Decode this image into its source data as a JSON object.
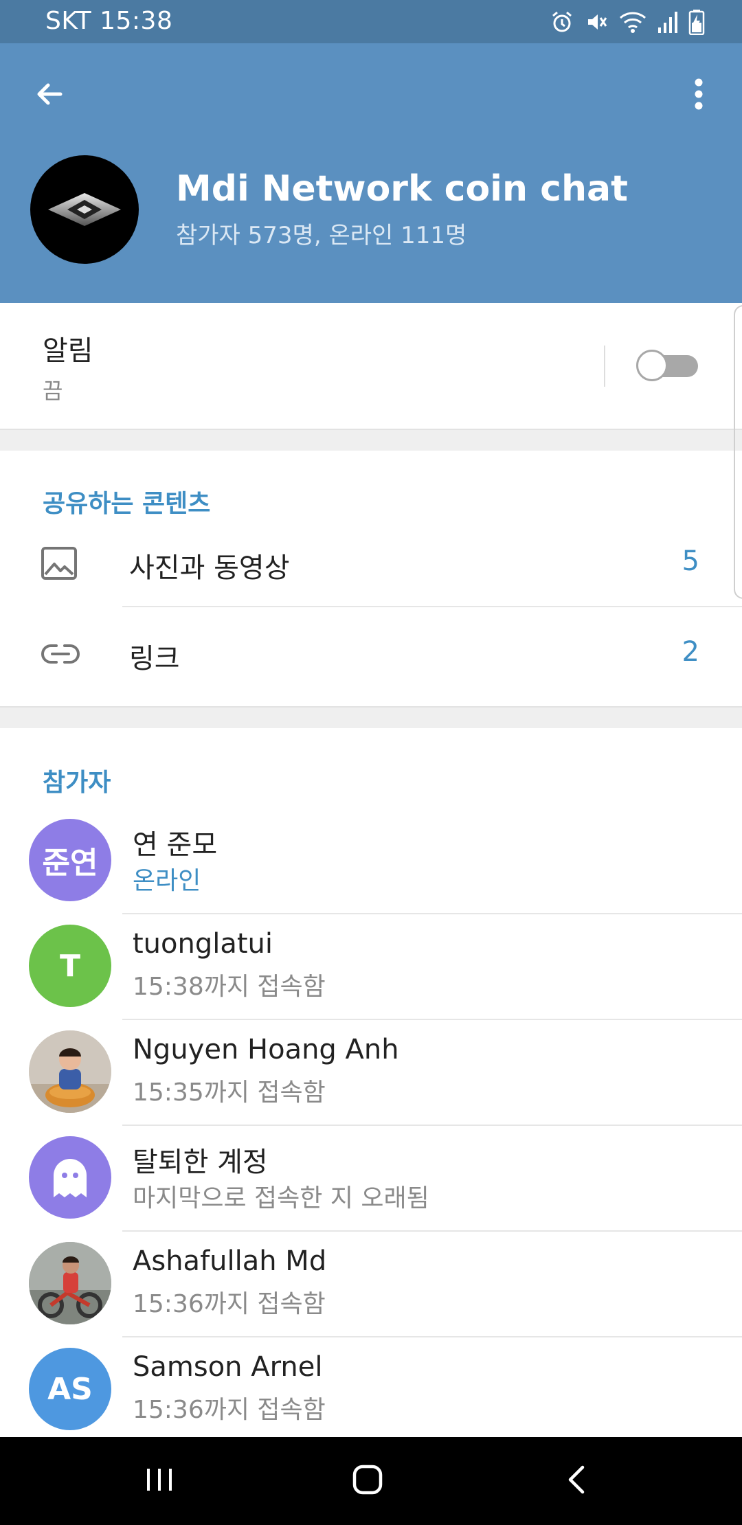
{
  "status_bar": {
    "carrier_time": "SKT 15:38",
    "icons": [
      "alarm-icon",
      "vibrate-mute-icon",
      "wifi-icon",
      "signal-icon",
      "battery-charging-icon"
    ]
  },
  "header": {
    "title": "Mdi Network coin chat",
    "subtitle": "참가자 573명, 온라인 111명",
    "back_icon": "back-arrow-icon",
    "menu_icon": "more-vertical-icon",
    "bg_color": "#5b90c0"
  },
  "notifications": {
    "label": "알림",
    "value": "끔",
    "enabled": false
  },
  "shared_content": {
    "title": "공유하는 콘텐츠",
    "items": [
      {
        "icon": "image-icon",
        "label": "사진과 동영상",
        "count": "5"
      },
      {
        "icon": "link-icon",
        "label": "링크",
        "count": "2"
      }
    ]
  },
  "members": {
    "title": "참가자",
    "items": [
      {
        "avatar_text": "준연",
        "avatar_color": "#8e7de6",
        "name": "연 준모",
        "status": "온라인",
        "online": true
      },
      {
        "avatar_text": "T",
        "avatar_color": "#6cc24a",
        "name": "tuonglatui",
        "status": "15:38까지 접속함",
        "online": false
      },
      {
        "avatar_text": "",
        "avatar_color": "#b9a48a",
        "name": "Nguyen Hoang Anh",
        "status": "15:35까지 접속함",
        "online": false
      },
      {
        "avatar_text": "",
        "avatar_color": "#8e7de6",
        "name": "탈퇴한 계정",
        "status": "마지막으로 접속한 지 오래됨",
        "online": false
      },
      {
        "avatar_text": "",
        "avatar_color": "#9a9f9a",
        "name": "Ashafullah Md",
        "status": "15:36까지 접속함",
        "online": false
      },
      {
        "avatar_text": "AS",
        "avatar_color": "#4e98e0",
        "name": "Samson Arnel",
        "status": "15:36까지 접속함",
        "online": false
      }
    ]
  },
  "nav_bar": {
    "buttons": [
      "recent-apps-icon",
      "home-icon",
      "back-icon"
    ]
  },
  "colors": {
    "accent": "#3e8ec4",
    "header": "#5b90c0",
    "status_bar": "#4b7aa2"
  }
}
